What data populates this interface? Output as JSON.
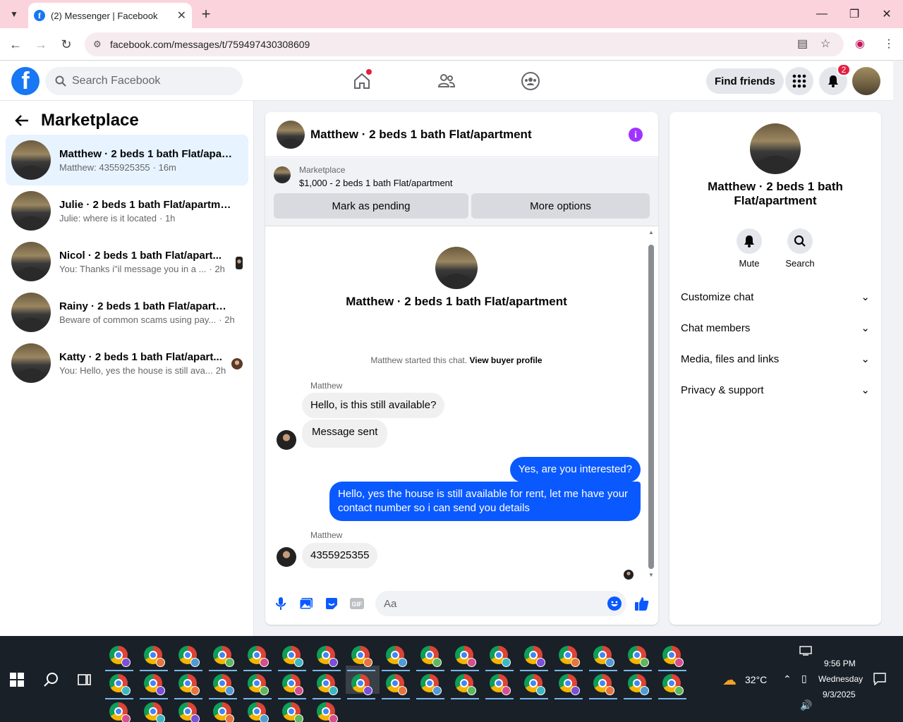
{
  "browser": {
    "tab_title": "(2) Messenger | Facebook",
    "url": "facebook.com/messages/t/759497430308609"
  },
  "header": {
    "search_placeholder": "Search Facebook",
    "find_friends": "Find friends",
    "notification_count": "2",
    "logo_letter": "f"
  },
  "left": {
    "title": "Marketplace",
    "conversations": [
      {
        "name": "Matthew · 2 beds 1 bath Flat/apart...",
        "preview": "Matthew: 4355925355",
        "time": "· 16m",
        "active": true
      },
      {
        "name": "Julie · 2 beds 1 bath Flat/apartment",
        "preview": "Julie: where is it located",
        "time": "· 1h"
      },
      {
        "name": "Nicol · 2 beds 1 bath Flat/apart...",
        "preview": "You: Thanks i\"il message you in a ...",
        "time": "· 2h"
      },
      {
        "name": "Rainy · 2 beds 1 bath Flat/apartment",
        "preview": "Beware of common scams using pay...",
        "time": "· 2h"
      },
      {
        "name": "Katty · 2 beds 1 bath Flat/apart...",
        "preview": "You: Hello, yes the house is still ava...",
        "time": "2h"
      }
    ]
  },
  "chat": {
    "title": "Matthew · 2 beds 1 bath Flat/apartment",
    "marketplace_label": "Marketplace",
    "listing": "$1,000 - 2 beds 1 bath Flat/apartment",
    "mark_pending": "Mark as pending",
    "more_options": "More options",
    "intro_name": "Matthew · 2 beds 1 bath Flat/apartment",
    "started_text": "Matthew started this chat.",
    "view_profile": "View buyer profile",
    "sender_name": "Matthew",
    "messages": [
      {
        "text": "Hello, is this still available?"
      },
      {
        "text": "Message sent"
      },
      {
        "text": "Yes, are you interested?"
      },
      {
        "text": "Hello, yes the house is still available for rent, let me have your contact number so i can send you details"
      },
      {
        "text": "4355925355"
      }
    ],
    "composer_placeholder": "Aa"
  },
  "right": {
    "name": "Matthew · 2 beds 1 bath Flat/apartment",
    "mute": "Mute",
    "search": "Search",
    "sections": [
      "Customize chat",
      "Chat members",
      "Media, files and links",
      "Privacy & support"
    ]
  },
  "taskbar": {
    "temperature": "32°C",
    "time": "9:56 PM",
    "day": "Wednesday",
    "date": "9/3/2025"
  },
  "colors": {
    "fb_blue": "#1877f2",
    "outgoing_bubble": "#0a59ff",
    "tabstrip": "#fbd3dc"
  }
}
